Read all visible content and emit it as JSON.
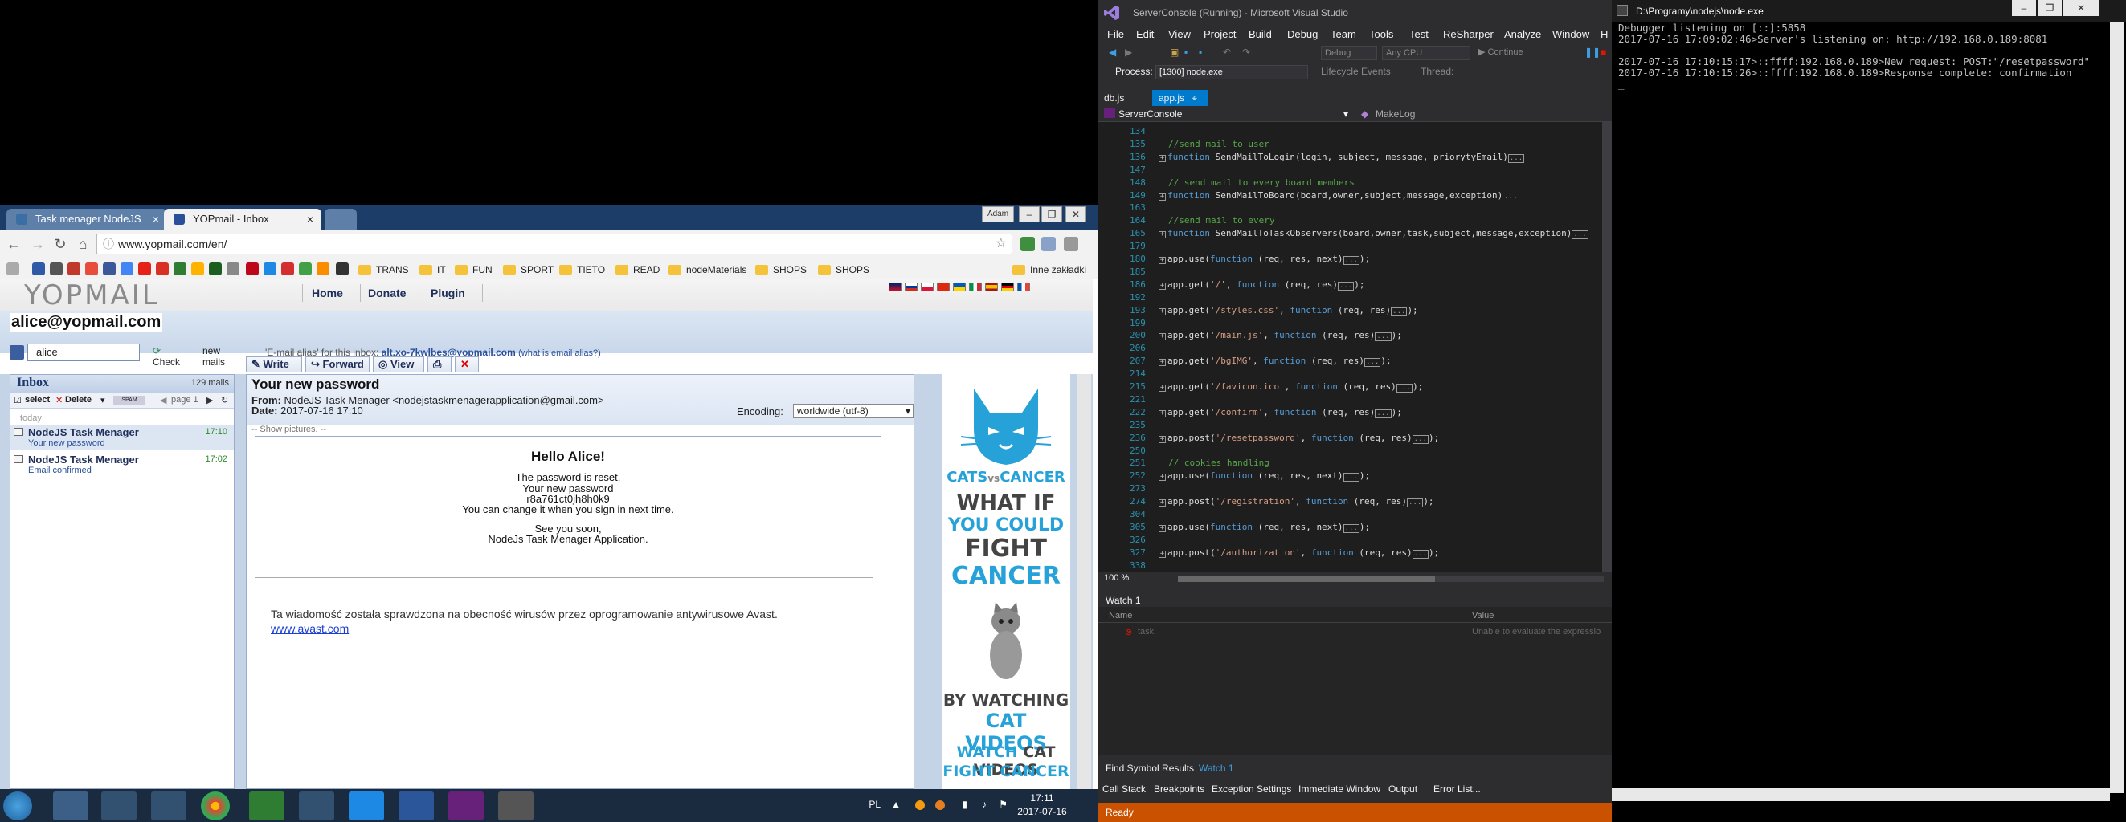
{
  "chrome": {
    "tabs": [
      {
        "label": "Task menager NodeJS"
      },
      {
        "label": "YOPmail - Inbox"
      }
    ],
    "user_button": "Adam",
    "url": "www.yopmail.com/en/",
    "bookmarks": [
      "TRANS",
      "IT",
      "FUN",
      "SPORT",
      "TIETO",
      "READ",
      "nodeMaterials",
      "SHOPS",
      "SHOPS"
    ],
    "other_bookmarks": "Inne zakładki"
  },
  "yopmail": {
    "logo": "YOPMAIL",
    "nav": [
      "Home",
      "Donate",
      "Plugin"
    ],
    "email": "alice@yopmail.com",
    "login_value": "alice",
    "check_label": "Check",
    "new_mails_label": "new mails",
    "alias_prefix": "'E-mail alias' for this inbox:",
    "alias": "alt.xo-7kwlbes@yopmail.com",
    "alias_help": "(what is email alias?)",
    "inbox": {
      "title": "Inbox",
      "count": "129 mails",
      "select": "select",
      "delete": "Delete",
      "page": "page 1",
      "day": "today",
      "items": [
        {
          "from": "NodeJS Task Menager",
          "subject": "Your new password",
          "time": "17:10"
        },
        {
          "from": "NodeJS Task Menager",
          "subject": "Email confirmed",
          "time": "17:02"
        }
      ]
    },
    "actions": [
      "Write",
      "Forward",
      "View"
    ],
    "mail": {
      "subject": "Your new password",
      "from_label": "From:",
      "from": "NodeJS Task Menager <nodejstaskmenagerapplication@gmail.com>",
      "date_label": "Date:",
      "date": "2017-07-16 17:10",
      "encoding_label": "Encoding:",
      "encoding": "worldwide (utf-8)",
      "show_pictures": "-- Show pictures. --",
      "hello": "Hello Alice!",
      "lines": [
        "The password is reset.",
        "Your new password",
        "r8a761ct0jh8h0k9",
        "You can change it when you sign in next time."
      ],
      "bye": [
        "See you soon,",
        "NodeJs Task Menager Application."
      ],
      "avast_text": "Ta wiadomość została sprawdzona na obecność wirusów przez oprogramowanie antywirusowe Avast.",
      "avast_link": "www.avast.com"
    },
    "ad": {
      "brand1": "CATS",
      "brand_vs": "vs",
      "brand2": "CANCER",
      "what_if": "WHAT IF",
      "you_could": "YOU COULD",
      "fight": "FIGHT",
      "cancer": "CANCER",
      "by_watching": "BY WATCHING",
      "cat_videos": "CAT VIDEOS",
      "watch": "WATCH",
      "cat_videos2": "CAT VIDEOS",
      "fight_cancer": "FIGHT CANCER"
    }
  },
  "taskbar": {
    "lang": "PL",
    "time": "17:11",
    "date": "2017-07-16"
  },
  "vs": {
    "title": "ServerConsole (Running) - Microsoft Visual Studio",
    "menu": [
      "File",
      "Edit",
      "View",
      "Project",
      "Build",
      "Debug",
      "Team",
      "Tools",
      "Test",
      "ReSharper",
      "Analyze",
      "Window",
      "H"
    ],
    "config": "Debug",
    "platform": "Any CPU",
    "continue": "Continue",
    "process_label": "Process:",
    "process": "[1300] node.exe",
    "lifecycle": "Lifecycle Events",
    "thread_label": "Thread:",
    "tabs": [
      "db.js",
      "app.js"
    ],
    "nav_left": "ServerConsole",
    "nav_right": "MakeLog",
    "code": [
      {
        "n": "134",
        "t": ""
      },
      {
        "n": "135",
        "c": "//send mail to user"
      },
      {
        "n": "136",
        "f": "function",
        "t": " SendMailToLogin(login, subject, message, priorytyEmail)"
      },
      {
        "n": "147",
        "t": ""
      },
      {
        "n": "148",
        "c": "// send mail to every board members"
      },
      {
        "n": "149",
        "f": "function",
        "t": " SendMailToBoard(board,owner,subject,message,exception)"
      },
      {
        "n": "163",
        "t": ""
      },
      {
        "n": "164",
        "c": "//send mail to every"
      },
      {
        "n": "165",
        "f": "function",
        "t": " SendMailToTaskObservers(board,owner,task,subject,message,exception)"
      },
      {
        "n": "179",
        "t": ""
      },
      {
        "n": "180",
        "t": "app.use(",
        "f": "function",
        "r": " (req, res, next)"
      },
      {
        "n": "185",
        "t": ""
      },
      {
        "n": "186",
        "t": "app.get(",
        "s": "'/'",
        "t2": ", ",
        "f": "function",
        "r": " (req, res)"
      },
      {
        "n": "192",
        "t": ""
      },
      {
        "n": "193",
        "t": "app.get(",
        "s": "'/styles.css'",
        "t2": ", ",
        "f": "function",
        "r": " (req, res)"
      },
      {
        "n": "199",
        "t": ""
      },
      {
        "n": "200",
        "t": "app.get(",
        "s": "'/main.js'",
        "t2": ", ",
        "f": "function",
        "r": " (req, res)"
      },
      {
        "n": "206",
        "t": ""
      },
      {
        "n": "207",
        "t": "app.get(",
        "s": "'/bgIMG'",
        "t2": ", ",
        "f": "function",
        "r": " (req, res)"
      },
      {
        "n": "214",
        "t": ""
      },
      {
        "n": "215",
        "t": "app.get(",
        "s": "'/favicon.ico'",
        "t2": ", ",
        "f": "function",
        "r": " (req, res)"
      },
      {
        "n": "221",
        "t": ""
      },
      {
        "n": "222",
        "t": "app.get(",
        "s": "'/confirm'",
        "t2": ", ",
        "f": "function",
        "r": " (req, res)"
      },
      {
        "n": "235",
        "t": ""
      },
      {
        "n": "236",
        "t": "app.post(",
        "s": "'/resetpassword'",
        "t2": ", ",
        "f": "function",
        "r": " (req, res)"
      },
      {
        "n": "250",
        "t": ""
      },
      {
        "n": "251",
        "c": "// cookies handling"
      },
      {
        "n": "252",
        "t": "app.use(",
        "f": "function",
        "r": " (req, res, next)"
      },
      {
        "n": "273",
        "t": ""
      },
      {
        "n": "274",
        "t": "app.post(",
        "s": "'/registration'",
        "t2": ", ",
        "f": "function",
        "r": " (req, res)"
      },
      {
        "n": "304",
        "t": ""
      },
      {
        "n": "305",
        "t": "app.use(",
        "f": "function",
        "r": " (req, res, next)"
      },
      {
        "n": "326",
        "t": ""
      },
      {
        "n": "327",
        "t": "app.post(",
        "s": "'/authorization'",
        "t2": ", ",
        "f": "function",
        "r": " (req, res)"
      },
      {
        "n": "338",
        "t": ""
      }
    ],
    "zoom": "100 %",
    "watch_title": "Watch 1",
    "watch_cols": [
      "Name",
      "Value"
    ],
    "watch_row": {
      "name": "task",
      "value": "Unable to evaluate the expressio"
    },
    "bottom_tabs": [
      "Find Symbol Results",
      "Watch 1"
    ],
    "bottom_tabs2": [
      "Call Stack",
      "Breakpoints",
      "Exception Settings",
      "Immediate Window",
      "Output",
      "Error List..."
    ],
    "status": "Ready"
  },
  "console": {
    "title": "D:\\Programy\\nodejs\\node.exe",
    "lines": [
      "Debugger listening on [::]:5858",
      "2017-07-16 17:09:02:46>Server's listening on: http://192.168.0.189:8081",
      "",
      "2017-07-16 17:10:15:17>::ffff:192.168.0.189>New request: POST:\"/resetpassword\"",
      "2017-07-16 17:10:15:26>::ffff:192.168.0.189>Response complete: confirmation"
    ]
  }
}
